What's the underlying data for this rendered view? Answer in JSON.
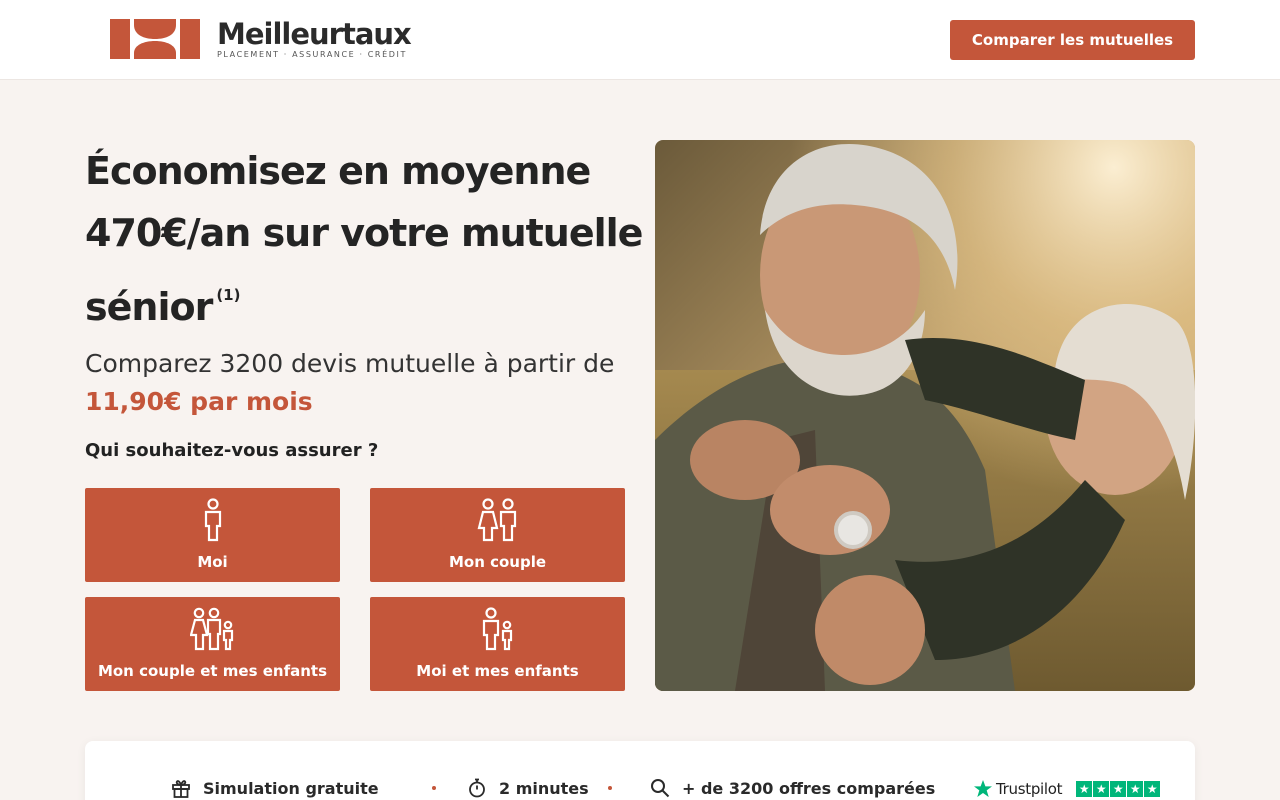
{
  "brand": {
    "name": "Meilleurtaux",
    "tagline": "PLACEMENT · ASSURANCE · CRÉDIT",
    "color": "#c4563a"
  },
  "header": {
    "cta_label": "Comparer les mutuelles"
  },
  "hero": {
    "title": "Économisez en moyenne 470€/an sur votre mutuelle sénior",
    "title_note": "(1)",
    "subtitle": "Comparez 3200 devis mutuelle à partir de",
    "price": "11,90€ par mois",
    "question": "Qui souhaitez-vous assurer ?"
  },
  "choices": [
    {
      "label": "Moi",
      "icon": "single-person-icon"
    },
    {
      "label": "Mon couple",
      "icon": "couple-icon"
    },
    {
      "label": "Mon couple et mes enfants",
      "icon": "family-icon"
    },
    {
      "label": "Moi et mes enfants",
      "icon": "parent-child-icon"
    }
  ],
  "features": [
    {
      "label": "Simulation gratuite",
      "icon": "gift-icon"
    },
    {
      "label": "2 minutes",
      "icon": "stopwatch-icon"
    },
    {
      "label": "+ de 3200 offres comparées",
      "icon": "search-icon"
    }
  ],
  "trustpilot": {
    "label": "Trustpilot",
    "stars": 5,
    "color": "#00b67a"
  }
}
